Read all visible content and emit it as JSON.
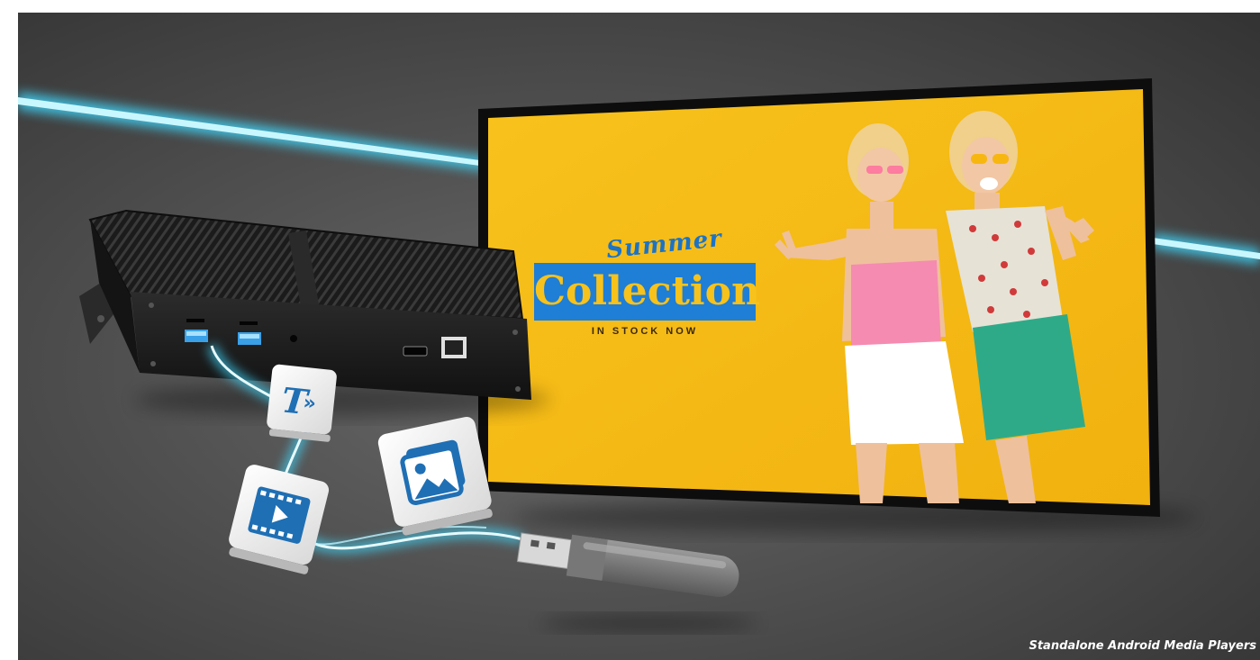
{
  "screen": {
    "headline_script": "Summer",
    "headline_main": "Collection",
    "subline": "IN STOCK NOW"
  },
  "caption": "Standalone Android Media Players",
  "colors": {
    "background": "#515151",
    "glow": "#46e6ff",
    "screen_bg": "#f6bd16",
    "banner": "#1f7ed6",
    "headline_text": "#f7c21c",
    "icon_blue": "#1f6fb4"
  },
  "icons": [
    "text-tile-icon",
    "video-tile-icon",
    "image-tile-icon"
  ]
}
